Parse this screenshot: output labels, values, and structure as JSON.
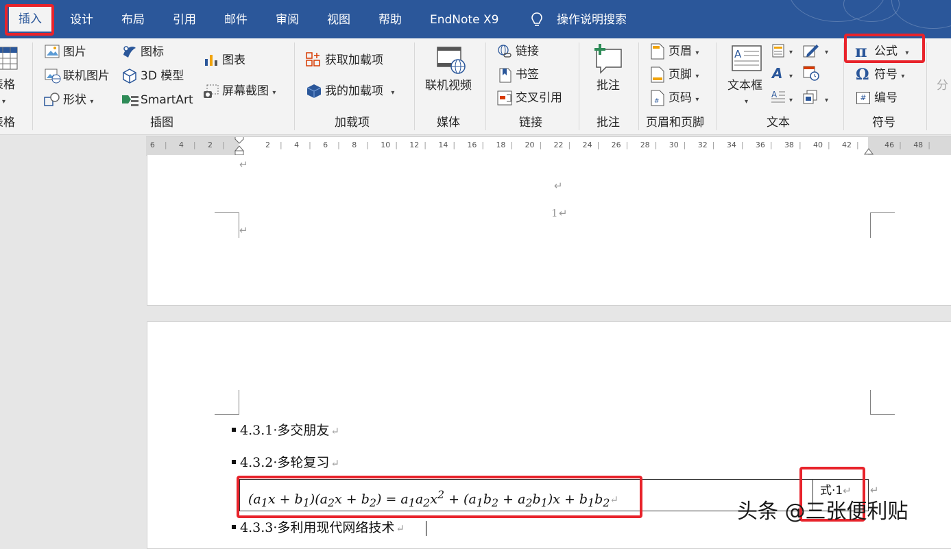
{
  "tabs": {
    "insert": "插入",
    "design": "设计",
    "layout": "布局",
    "references": "引用",
    "mailings": "邮件",
    "review": "审阅",
    "view": "视图",
    "help": "帮助",
    "endnote": "EndNote X9",
    "tell_me": "操作说明搜索"
  },
  "ribbon": {
    "tables": {
      "table_label": "表格",
      "group": "表格"
    },
    "illustrations": {
      "pictures": "图片",
      "online_pictures": "联机图片",
      "shapes": "形状",
      "icons": "图标",
      "models_3d": "3D 模型",
      "smartart": "SmartArt",
      "chart": "图表",
      "screenshot": "屏幕截图",
      "group": "插图"
    },
    "addins": {
      "get_addins": "获取加载项",
      "my_addins": "我的加载项",
      "group": "加载项"
    },
    "media": {
      "online_video": "联机视频",
      "group": "媒体"
    },
    "links": {
      "link": "链接",
      "bookmark": "书签",
      "cross_reference": "交叉引用",
      "group": "链接"
    },
    "comments": {
      "comment": "批注",
      "group": "批注"
    },
    "header_footer": {
      "header": "页眉",
      "footer": "页脚",
      "page_number": "页码",
      "group": "页眉和页脚"
    },
    "text": {
      "textbox": "文本框",
      "group": "文本"
    },
    "symbols": {
      "equation": "公式",
      "symbol": "符号",
      "number": "编号",
      "group": "符号"
    },
    "cut_off": {
      "extra": "分"
    },
    "icons": {
      "pi": "π",
      "omega": "Ω",
      "hash": "#",
      "wordart": "A",
      "lightbulb": "lightbulb-icon"
    }
  },
  "ruler": {
    "left_labels": [
      "6",
      "4",
      "2"
    ],
    "labels": [
      "2",
      "4",
      "6",
      "8",
      "10",
      "12",
      "14",
      "16",
      "18",
      "20",
      "22",
      "24",
      "26",
      "28",
      "30",
      "32",
      "34",
      "36",
      "38",
      "40",
      "42"
    ],
    "right_labels": [
      "46",
      "48"
    ]
  },
  "document": {
    "page1_number": "1",
    "headings": {
      "h1": "4.3.1·多交朋友",
      "h2": "4.3.2·多轮复习",
      "h3": "4.3.3·多利用现代网络技术"
    },
    "equation_label": "式·1",
    "para_mark": "↵"
  },
  "watermark": "头条 @三张便利贴",
  "colors": {
    "ribbon_blue": "#2b579a",
    "highlight_red": "#e8232b"
  }
}
